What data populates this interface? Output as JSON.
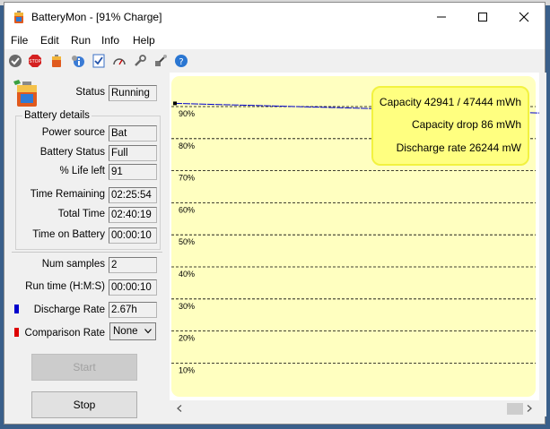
{
  "window": {
    "title": "BatteryMon - [91% Charge]"
  },
  "menu": [
    "File",
    "Edit",
    "Run",
    "Info",
    "Help"
  ],
  "toolbar_icons": [
    "check-icon",
    "stop-icon",
    "battery-icon",
    "info-icon",
    "checklist-icon",
    "gauge-icon",
    "wrench-icon",
    "tools-icon",
    "help-icon"
  ],
  "status": {
    "label": "Status",
    "value": "Running"
  },
  "battery_details": {
    "title": "Battery details",
    "fields": [
      {
        "label": "Power source",
        "value": "Bat"
      },
      {
        "label": "Battery Status",
        "value": "Full"
      },
      {
        "label": "% Life left",
        "value": "91"
      },
      {
        "label": "Time Remaining",
        "value": "02:25:54"
      },
      {
        "label": "Total Time",
        "value": "02:40:19"
      },
      {
        "label": "Time on Battery",
        "value": "00:00:10"
      }
    ]
  },
  "samples": {
    "num_samples": {
      "label": "Num samples",
      "value": "2"
    },
    "run_time": {
      "label": "Run time (H:M:S)",
      "value": "00:00:10"
    },
    "discharge_rate": {
      "label": "Discharge Rate",
      "value": "2.67h"
    },
    "comparison_rate": {
      "label": "Comparison Rate",
      "value": "None"
    }
  },
  "buttons": {
    "start": "Start",
    "stop": "Stop"
  },
  "colors": {
    "discharge": "#0000cc",
    "comparison": "#dd0000",
    "chart_bg": "#ffffc0",
    "info_box": "#ffff80"
  },
  "chart_data": {
    "type": "line",
    "y_ticks": [
      "90%",
      "80%",
      "70%",
      "60%",
      "50%",
      "40%",
      "30%",
      "20%",
      "10%"
    ],
    "ylim": [
      0,
      100
    ],
    "series": [
      {
        "values": [
          91,
          88
        ]
      }
    ],
    "info": {
      "capacity": "Capacity 42941 / 47444 mWh",
      "capacity_drop": "Capacity drop 86 mWh",
      "discharge": "Discharge rate 26244 mW"
    }
  }
}
